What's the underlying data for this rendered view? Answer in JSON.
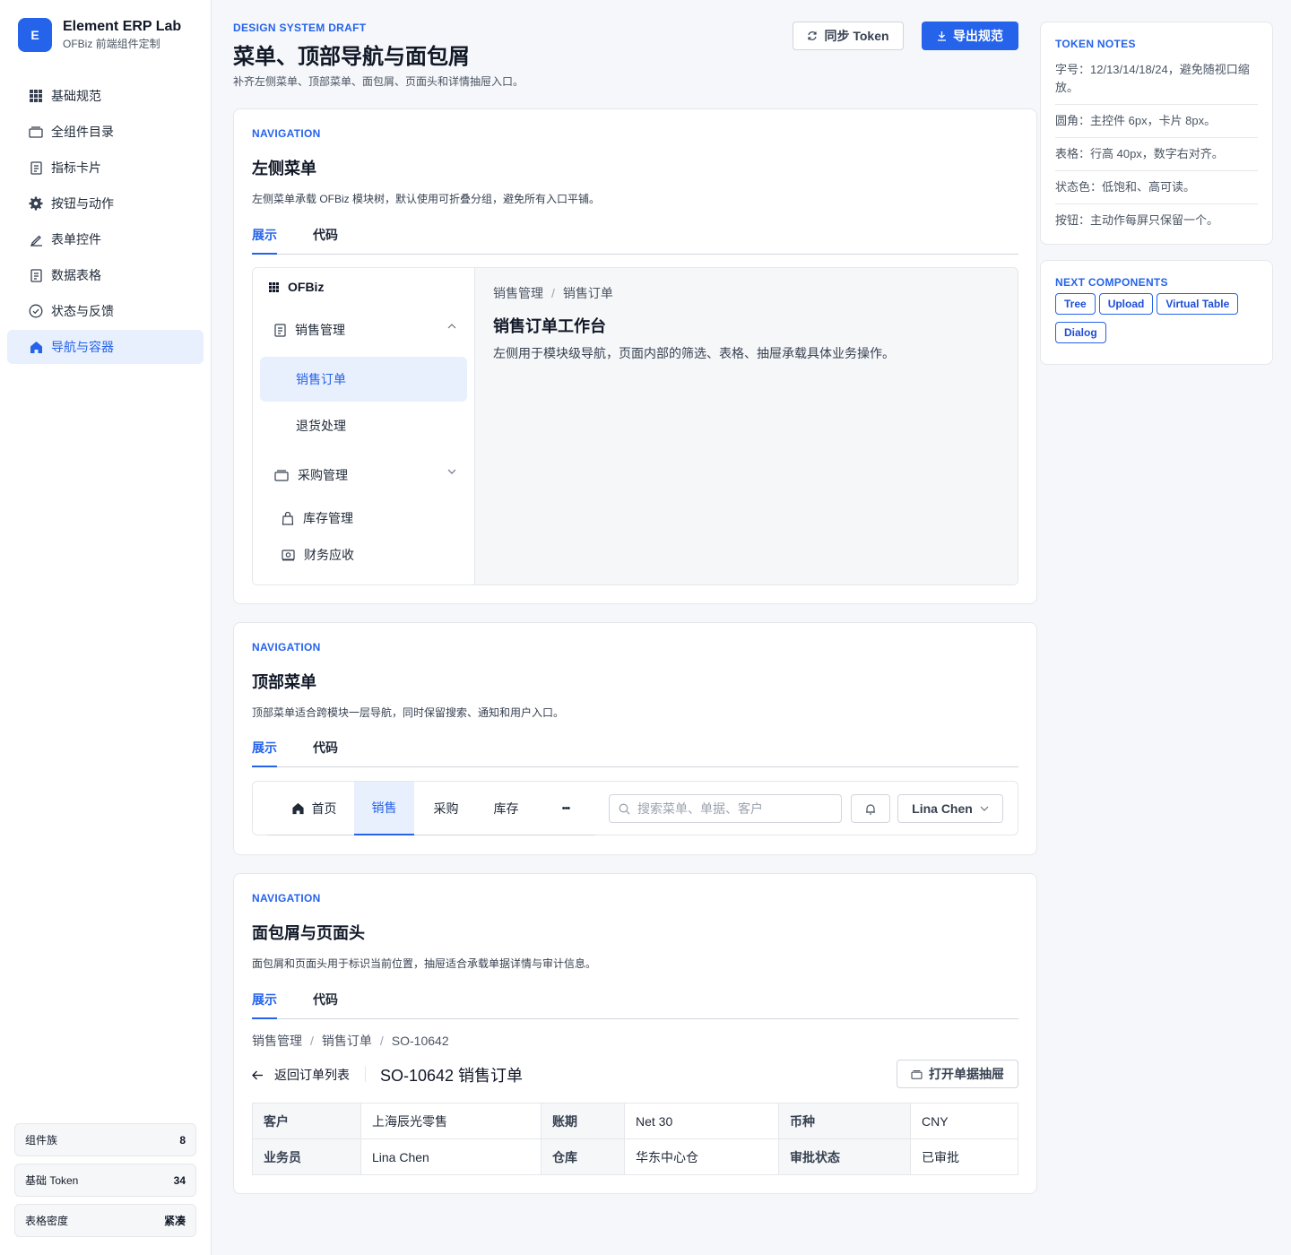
{
  "brand": {
    "logo": "E",
    "title": "Element ERP Lab",
    "subtitle": "OFBiz 前端组件定制"
  },
  "sidebar": {
    "items": [
      {
        "label": "基础规范",
        "icon": "grid-icon"
      },
      {
        "label": "全组件目录",
        "icon": "folder-icon"
      },
      {
        "label": "指标卡片",
        "icon": "document-icon"
      },
      {
        "label": "按钮与动作",
        "icon": "gear-icon"
      },
      {
        "label": "表单控件",
        "icon": "pen-icon"
      },
      {
        "label": "数据表格",
        "icon": "document-icon"
      },
      {
        "label": "状态与反馈",
        "icon": "check-circle-icon"
      },
      {
        "label": "导航与容器",
        "icon": "home-icon",
        "active": true
      }
    ],
    "stats": [
      {
        "label": "组件族",
        "value": "8"
      },
      {
        "label": "基础 Token",
        "value": "34"
      },
      {
        "label": "表格密度",
        "value": "紧凑"
      }
    ]
  },
  "header": {
    "eyebrow": "DESIGN SYSTEM DRAFT",
    "title": "菜单、顶部导航与面包屑",
    "desc": "补齐左侧菜单、顶部菜单、面包屑、页面头和详情抽屉入口。",
    "sync_label": "同步 Token",
    "export_label": "导出规范"
  },
  "tabs": {
    "show": "展示",
    "code": "代码"
  },
  "card1": {
    "eyebrow": "NAVIGATION",
    "title": "左侧菜单",
    "desc": "左侧菜单承载 OFBiz 模块树，默认使用可折叠分组，避免所有入口平铺。",
    "menu_title": "OFBiz",
    "menu": {
      "group1": "销售管理",
      "sub1": "销售订单",
      "sub2": "退货处理",
      "group2": "采购管理",
      "item3": "库存管理",
      "item4": "财务应收"
    },
    "crumb": [
      "销售管理",
      "销售订单"
    ],
    "main_title": "销售订单工作台",
    "main_desc": "左侧用于模块级导航，页面内部的筛选、表格、抽屉承载具体业务操作。"
  },
  "card2": {
    "eyebrow": "NAVIGATION",
    "title": "顶部菜单",
    "desc": "顶部菜单适合跨模块一层导航，同时保留搜索、通知和用户入口。",
    "nav": {
      "home": "首页",
      "sales": "销售",
      "purchase": "采购",
      "stock": "库存",
      "more": "•••"
    },
    "search_placeholder": "搜索菜单、单据、客户",
    "user": "Lina Chen"
  },
  "card3": {
    "eyebrow": "NAVIGATION",
    "title": "面包屑与页面头",
    "desc": "面包屑和页面头用于标识当前位置，抽屉适合承载单据详情与审计信息。",
    "crumb": [
      "销售管理",
      "销售订单",
      "SO-10642"
    ],
    "back": "返回订单列表",
    "title_main": "SO-10642 销售订单",
    "open_drawer": "打开单据抽屉",
    "table": [
      [
        "客户",
        "上海辰光零售",
        "账期",
        "Net 30",
        "币种",
        "CNY"
      ],
      [
        "业务员",
        "Lina Chen",
        "仓库",
        "华东中心仓",
        "审批状态",
        "已审批"
      ]
    ]
  },
  "token_notes": {
    "title": "TOKEN NOTES",
    "items": [
      "字号：12/13/14/18/24，避免随视口缩放。",
      "圆角：主控件 6px，卡片 8px。",
      "表格：行高 40px，数字右对齐。",
      "状态色：低饱和、高可读。",
      "按钮：主动作每屏只保留一个。"
    ]
  },
  "next_components": {
    "title": "NEXT COMPONENTS",
    "chips": [
      "Tree",
      "Upload",
      "Virtual Table",
      "Dialog"
    ]
  },
  "colors": {
    "accent": "#2563eb",
    "accent_soft": "#e8effd",
    "border": "#e5e7eb",
    "bg": "#f5f7fa"
  }
}
